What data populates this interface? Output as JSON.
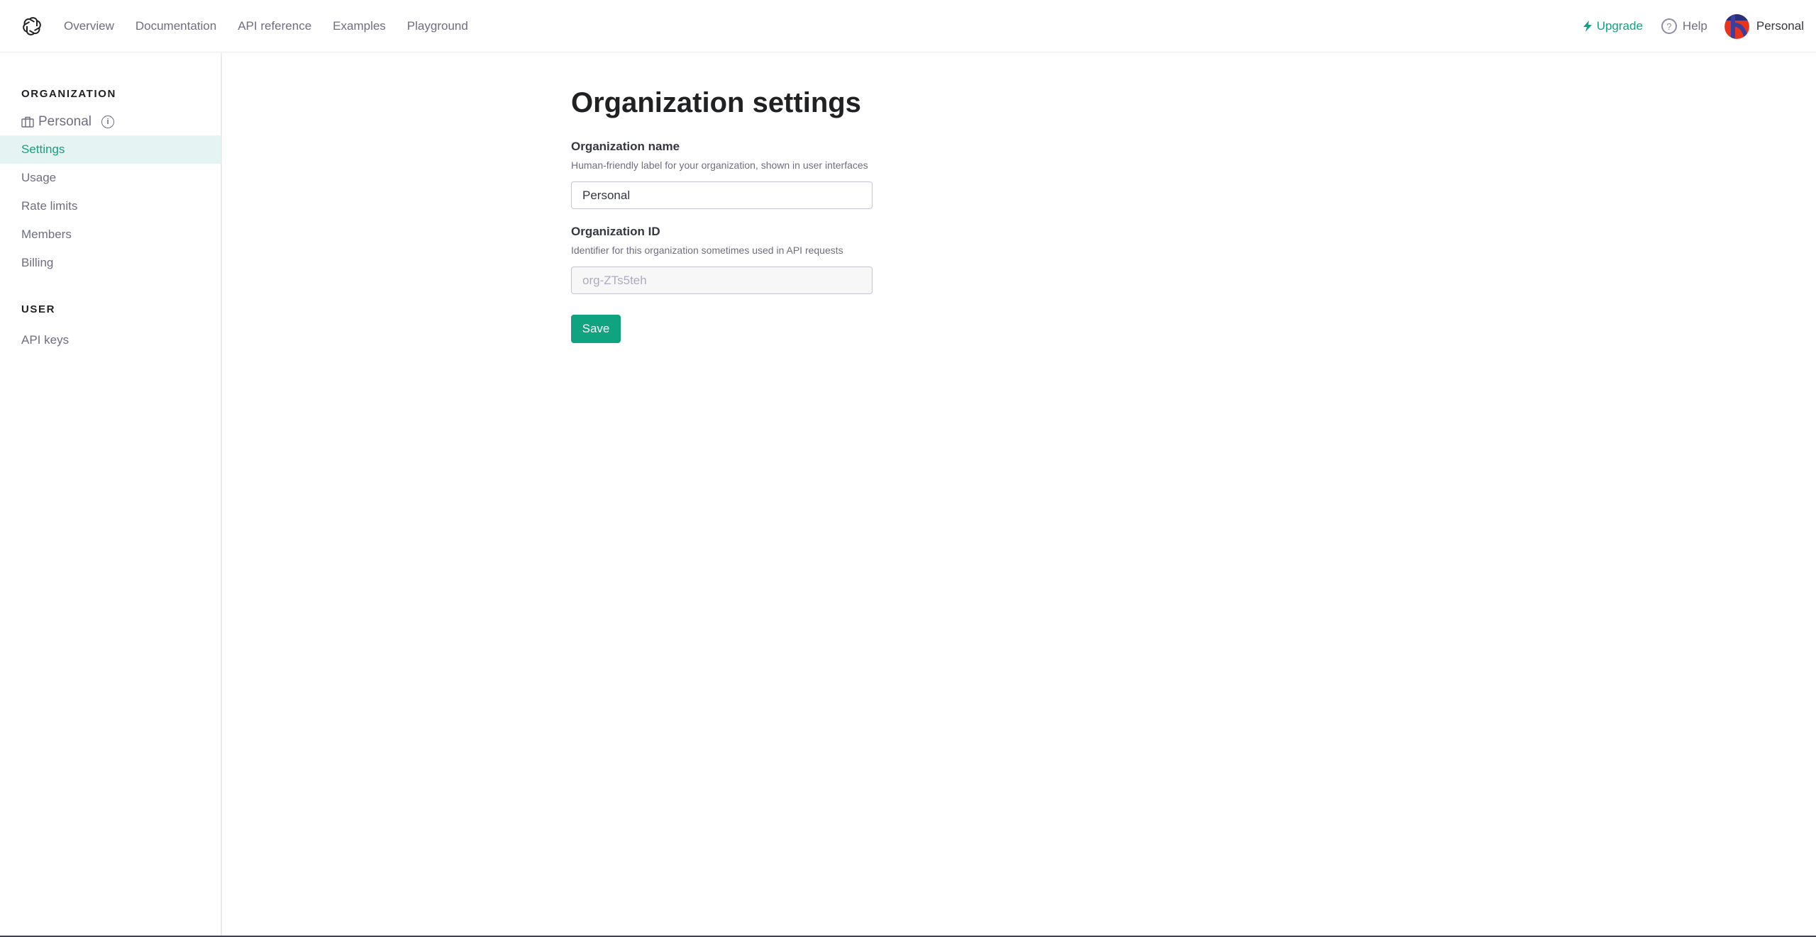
{
  "topbar": {
    "logo": "openai-logo-icon",
    "nav": [
      {
        "label": "Overview"
      },
      {
        "label": "Documentation"
      },
      {
        "label": "API reference"
      },
      {
        "label": "Examples"
      },
      {
        "label": "Playground"
      }
    ],
    "upgrade_label": "Upgrade",
    "upgrade_icon": "lightning-bolt-icon",
    "help_label": "Help",
    "help_icon": "question-circle-icon",
    "help_glyph": "?",
    "account_label": "Personal",
    "brand_color": "#10a37f"
  },
  "sidebar": {
    "org_section_title": "ORGANIZATION",
    "org_name": "Personal",
    "org_info_glyph": "i",
    "items": [
      {
        "label": "Settings",
        "active": true
      },
      {
        "label": "Usage",
        "active": false
      },
      {
        "label": "Rate limits",
        "active": false
      },
      {
        "label": "Members",
        "active": false
      },
      {
        "label": "Billing",
        "active": false
      }
    ],
    "user_section_title": "USER",
    "user_items": [
      {
        "label": "API keys"
      }
    ]
  },
  "main": {
    "title": "Organization settings",
    "org_name_field": {
      "label": "Organization name",
      "help": "Human-friendly label for your organization, shown in user interfaces",
      "value": "Personal"
    },
    "org_id_field": {
      "label": "Organization ID",
      "help": "Identifier for this organization sometimes used in API requests",
      "value": "org-ZTs5teh",
      "disabled": true
    },
    "save_label": "Save"
  }
}
